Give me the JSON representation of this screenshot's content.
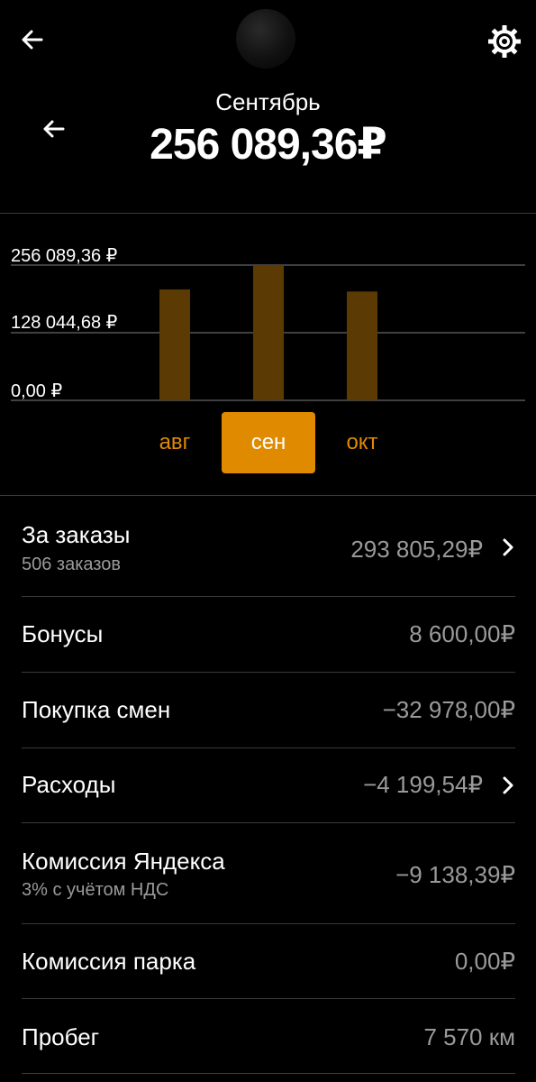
{
  "header": {
    "month": "Сентябрь",
    "total": "256 089,36₽"
  },
  "chart_data": {
    "type": "bar",
    "categories": [
      "авг",
      "сен",
      "окт"
    ],
    "values": [
      210000,
      256089.36,
      206000
    ],
    "ylim": [
      0,
      256089.36
    ],
    "yticks": [
      "256 089,36 ₽",
      "128 044,68 ₽",
      "0,00 ₽"
    ],
    "selected": "сен",
    "bar_color": "#5c3a04",
    "grid": true
  },
  "months": [
    {
      "label": "авг"
    },
    {
      "label": "сен"
    },
    {
      "label": "окт"
    }
  ],
  "rows": [
    {
      "label": "За заказы",
      "sub": "506 заказов",
      "value": "293 805,29₽",
      "chevron": true
    },
    {
      "label": "Бонусы",
      "value": "8 600,00₽"
    },
    {
      "label": "Покупка смен",
      "value": "−32 978,00₽"
    },
    {
      "label": "Расходы",
      "value": "−4 199,54₽",
      "chevron": true
    },
    {
      "label": "Комиссия Яндекса",
      "sub": "3% с учётом НДС",
      "value": "−9 138,39₽"
    },
    {
      "label": "Комиссия парка",
      "value": "0,00₽"
    },
    {
      "label": "Пробег",
      "value": "7 570 км"
    }
  ],
  "colors": {
    "accent": "#e08a00",
    "background": "#000000",
    "muted": "#9a9a9a"
  },
  "icons": {
    "back": "arrow-left-icon",
    "settings": "gear-icon"
  }
}
